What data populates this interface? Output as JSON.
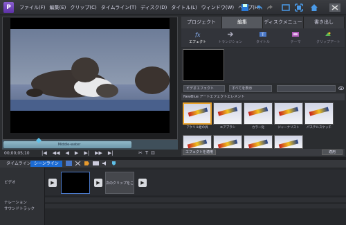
{
  "app": {
    "logo_letter": "P"
  },
  "menu": [
    "ファイル(F)",
    "編集(E)",
    "クリップ(C)",
    "タイムライン(T)",
    "ディスク(D)",
    "タイトル(L)",
    "ウィンドウ(W)",
    "ヘルプ(H)"
  ],
  "toolbar_icons": [
    "save-icon",
    "undo-icon",
    "redo-icon",
    "fullscreen-icon",
    "window-icon",
    "home-icon"
  ],
  "monitor": {
    "scrub_label": "Middle-water",
    "timecode": "00;00;05;10"
  },
  "transport": [
    "|◀",
    "◀◀",
    "◀",
    "▶",
    "▶|",
    "▶▶",
    "▶|"
  ],
  "right_controls": [
    "✂",
    "T",
    "⊡"
  ],
  "tabs": [
    "プロジェクト",
    "編集",
    "ディスクメニュー",
    "書き出し"
  ],
  "active_tab": 1,
  "subtabs": [
    {
      "label": "エフェクト",
      "icon": "fx-icon"
    },
    {
      "label": "トランジション",
      "icon": "transition-icon"
    },
    {
      "label": "タイトル",
      "icon": "title-icon"
    },
    {
      "label": "テーマ",
      "icon": "theme-icon"
    },
    {
      "label": "クリップアート",
      "icon": "clipart-icon"
    }
  ],
  "filters": {
    "category": "ビデオエフェクト",
    "show": "すべてを表示"
  },
  "group_label": "NewBlue アートエフェクトエレメント",
  "thumbnails": [
    {
      "label": "アクリル絵の具"
    },
    {
      "label": "エアブラシ"
    },
    {
      "label": "カラー化"
    },
    {
      "label": "ジャーナリスト"
    },
    {
      "label": "パステルスケッチ"
    }
  ],
  "apply_button": "エフェクトを適用",
  "apply_button2": "適用",
  "timeline_tabs": [
    "タイムライン",
    "シーンライン"
  ],
  "active_timeline_tab": 1,
  "tracks": {
    "video": "ビデオ",
    "narration": "ナレーション",
    "soundtrack": "サウンドトラック"
  },
  "clip_placeholder": "次のクリップをここ..."
}
